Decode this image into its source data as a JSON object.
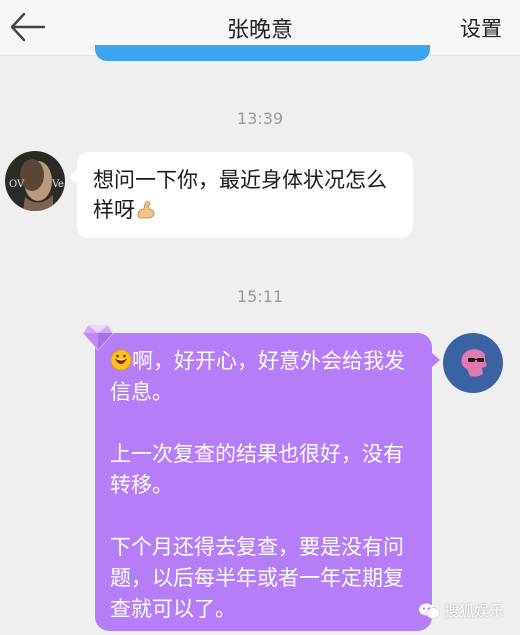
{
  "header": {
    "title": "张晚意",
    "settings_label": "设置"
  },
  "messages": [
    {
      "time": "13:39",
      "sender": "contact",
      "text": "想问一下你，最近身体状况怎么样呀"
    },
    {
      "time": "15:11",
      "sender": "self",
      "paragraphs": [
        "啊，好开心，好意外会给我发信息。",
        "上一次复查的结果也很好，没有转移。",
        "下个月还得去复查，要是没有问题，以后每半年或者一年定期复查就可以了。"
      ]
    }
  ],
  "icons": {
    "back": "arrow-left-icon",
    "flex_emoji": "flexed-biceps-emoji",
    "grin_emoji": "grinning-face-emoji",
    "gem": "diamond-icon"
  },
  "watermark": "搜狐娱乐",
  "colors": {
    "self_bubble": "#b57df8",
    "contact_bubble": "#ffffff",
    "background": "#efefef"
  }
}
